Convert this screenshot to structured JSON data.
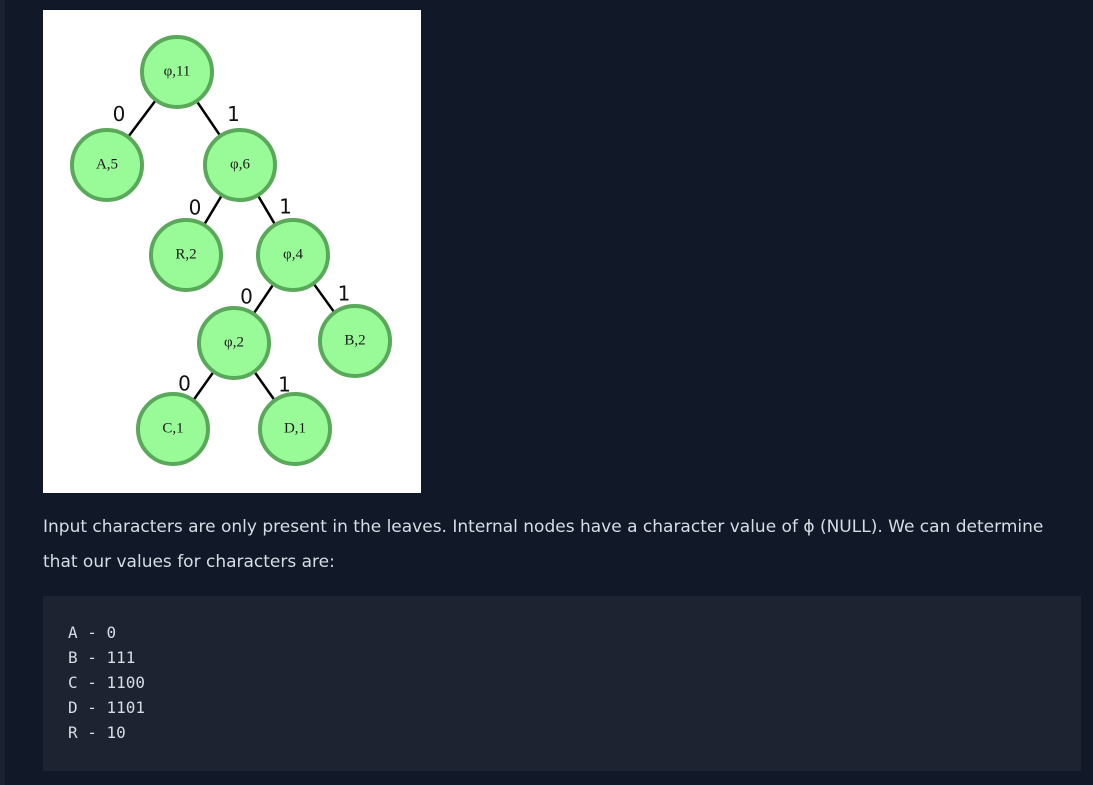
{
  "tree": {
    "nodes": [
      {
        "id": "root",
        "label": "φ,11"
      },
      {
        "id": "a",
        "label": "A,5"
      },
      {
        "id": "n6",
        "label": "φ,6"
      },
      {
        "id": "r",
        "label": "R,2"
      },
      {
        "id": "n4",
        "label": "φ,4"
      },
      {
        "id": "n2",
        "label": "φ,2"
      },
      {
        "id": "b",
        "label": "B,2"
      },
      {
        "id": "c",
        "label": "C,1"
      },
      {
        "id": "d",
        "label": "D,1"
      }
    ],
    "edges": [
      {
        "from": "root",
        "to": "a",
        "label": "0"
      },
      {
        "from": "root",
        "to": "n6",
        "label": "1"
      },
      {
        "from": "n6",
        "to": "r",
        "label": "0"
      },
      {
        "from": "n6",
        "to": "n4",
        "label": "1"
      },
      {
        "from": "n4",
        "to": "n2",
        "label": "0"
      },
      {
        "from": "n4",
        "to": "b",
        "label": "1"
      },
      {
        "from": "n2",
        "to": "c",
        "label": "0"
      },
      {
        "from": "n2",
        "to": "d",
        "label": "1"
      }
    ]
  },
  "paragraph": "Input characters are only present in the leaves. Internal nodes have a character value of ϕ (NULL). We can determine that our values for characters are:",
  "code_lines": [
    "A - 0",
    "B - 111",
    "C - 1100",
    "D - 1101",
    "R - 10"
  ],
  "colors": {
    "background": "#111827",
    "node_fill": "#98fb98",
    "node_stroke": "#5aa85a",
    "code_background": "#1d2330",
    "text": "#d7dde6"
  }
}
